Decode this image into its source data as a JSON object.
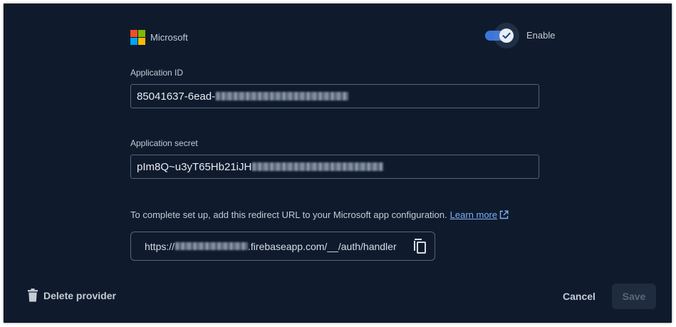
{
  "provider": {
    "name": "Microsoft",
    "logo_colors": [
      "#f25022",
      "#7fba00",
      "#00a4ef",
      "#ffb900"
    ]
  },
  "enable_toggle": {
    "label": "Enable",
    "checked": true,
    "accent": "#3b77d8"
  },
  "application_id": {
    "label": "Application ID",
    "value_visible": "85041637-6ead-"
  },
  "application_secret": {
    "label": "Application secret",
    "value_visible": "pIm8Q~u3yT65Hb21iJH"
  },
  "redirect": {
    "info_text": "To complete set up, add this redirect URL to your Microsoft app configuration.",
    "learn_more_label": "Learn more",
    "url_prefix": "https://",
    "url_suffix": ".firebaseapp.com/__/auth/handler"
  },
  "footer": {
    "delete_label": "Delete provider",
    "cancel_label": "Cancel",
    "save_label": "Save"
  },
  "colors": {
    "background": "#0f1b2d",
    "link": "#7fb0f5"
  },
  "icons": [
    "microsoft-logo",
    "check-icon",
    "external-link-icon",
    "copy-icon",
    "trash-icon"
  ]
}
